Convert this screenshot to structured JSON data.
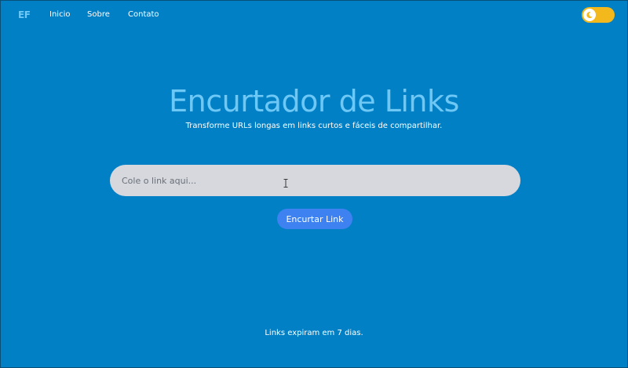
{
  "nav": {
    "logo": "EF",
    "links": [
      "Inicio",
      "Sobre",
      "Contato"
    ],
    "theme_toggle_icon": "moon-icon"
  },
  "hero": {
    "title": "Encurtador de Links",
    "subtitle": "Transforme URLs longas em links curtos e fáceis de compartilhar."
  },
  "form": {
    "input_value": "",
    "input_placeholder": "Cole o link aqui...",
    "button_label": "Encurtar Link"
  },
  "footer": {
    "note": "Links expiram em 7 dias."
  },
  "colors": {
    "background": "#0280c6",
    "accent_title": "#6ec8f5",
    "toggle": "#f2b81c",
    "button": "#3d82f0",
    "input_bg": "#d6d8de"
  }
}
